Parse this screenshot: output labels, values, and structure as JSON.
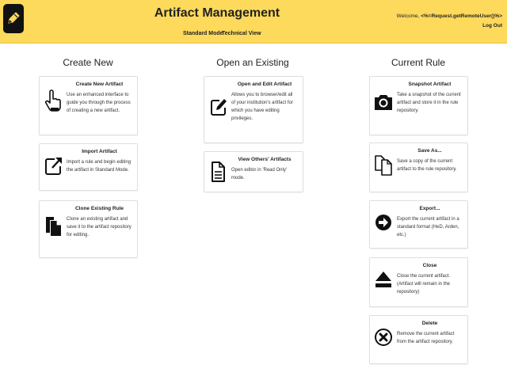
{
  "header": {
    "title": "Artifact Management",
    "nav": [
      "Standard Mode",
      "Technical View"
    ],
    "welcome_prefix": "Welcome, ",
    "welcome_user": "<%=Request.getRemoteUser()%>",
    "logout": "Log Out"
  },
  "columns": [
    {
      "title": "Create New",
      "cards": [
        {
          "title": "Create New Artifact",
          "icon": "pointing-hand-icon",
          "desc": "Use an enhanced interface to guide you through the process of creating a new artifact."
        },
        {
          "title": "Import Artifact",
          "icon": "external-link-icon",
          "desc": "Import a rule and begin editing the artifact in Standard Mode."
        },
        {
          "title": "Clone Existing Rule",
          "icon": "copy-icon",
          "desc": "Clone an existing artifact and save it to the artifact repository for editing."
        }
      ]
    },
    {
      "title": "Open an Existing",
      "cards": [
        {
          "title": "Open and Edit Artifact",
          "icon": "edit-icon",
          "desc": "Allows you to browser/edit all of your institution's artifact for which you have editing privileges."
        },
        {
          "title": "View Others' Artifacts",
          "icon": "document-icon",
          "desc": "Open editor in 'Read Only' mode."
        }
      ]
    },
    {
      "title": "Current Rule",
      "cards": [
        {
          "title": "Snapshot Artifact",
          "icon": "camera-icon",
          "desc": "Take a snapshot of the current artifact and store it in the rule repository."
        },
        {
          "title": "Save As...",
          "icon": "files-icon",
          "desc": "Save a copy of the current artifact to the rule repository."
        },
        {
          "title": "Export...",
          "icon": "arrow-circle-right-icon",
          "desc": "Export the current artifact in a standard format (HeD, Arden, etc.)"
        },
        {
          "title": "Close",
          "icon": "eject-icon",
          "desc": "Close the current artifact. (Artifact will remain in the repository)"
        },
        {
          "title": "Delete",
          "icon": "remove-circle-icon",
          "desc": "Remove the current artifact from the artifact repository."
        }
      ]
    }
  ],
  "colors": {
    "header_bg": "#fdd95c",
    "logo_bg": "#111111",
    "card_border": "#dedede"
  }
}
